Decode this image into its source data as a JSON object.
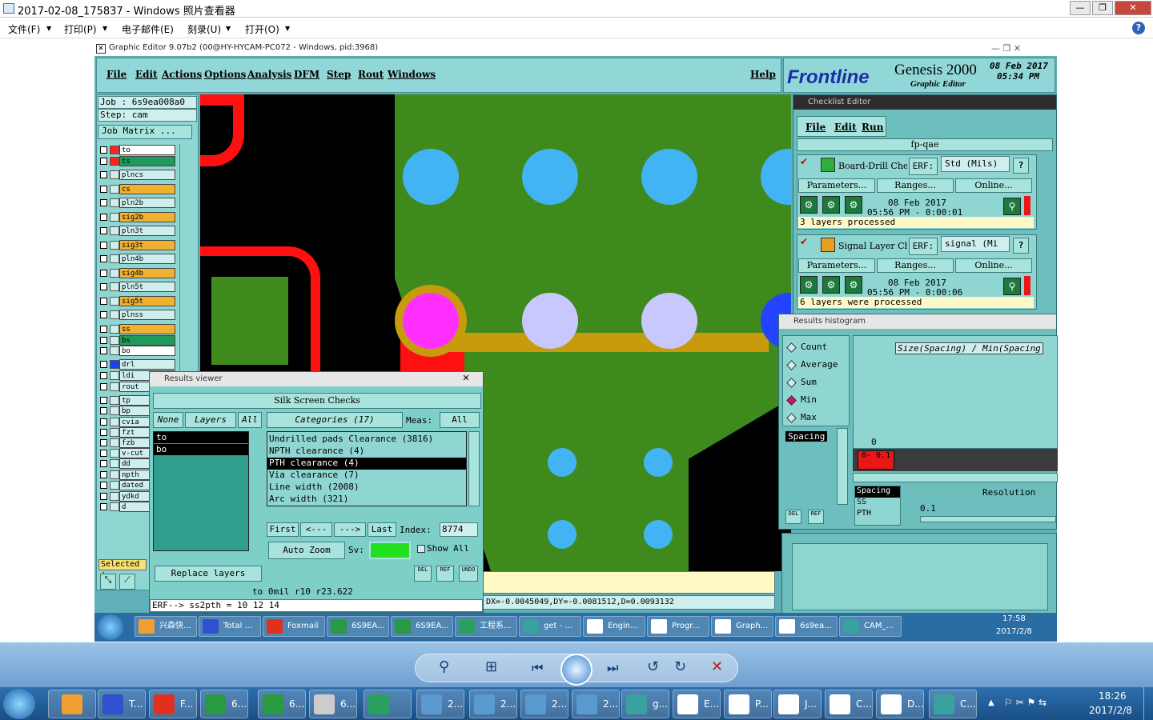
{
  "photo_viewer": {
    "title": "2017-02-08_175837 - Windows 照片查看器",
    "menu": [
      "文件(F)",
      "打印(P)",
      "电子邮件(E)",
      "刻录(U)",
      "打开(O)"
    ]
  },
  "graphic_editor": {
    "title": "Graphic Editor 9.07b2 (00@HY-HYCAM-PC072 - Windows, pid:3968)",
    "menu": [
      "File",
      "Edit",
      "Actions",
      "Options",
      "Analysis",
      "DFM",
      "Step",
      "Rout",
      "Windows"
    ],
    "help": "Help",
    "brand": "Frontline",
    "product": "Genesis 2000",
    "subtitle": "Graphic Editor",
    "date": "08 Feb 2017",
    "time": "05:34 PM",
    "job_label": "Job : 6s9ea008a0",
    "step_label": "Step: cam",
    "job_matrix": "Job Matrix ...",
    "layers": [
      {
        "name": "to",
        "color": "#ffffff"
      },
      {
        "name": "ts",
        "color": "#1f9a5a"
      },
      {
        "name": "plncs",
        "color": "#cfeeee"
      },
      {
        "name": "cs",
        "color": "#f0b030"
      },
      {
        "name": "pln2b",
        "color": "#cfeeee"
      },
      {
        "name": "sig2b",
        "color": "#f0b030"
      },
      {
        "name": "pln3t",
        "color": "#cfeeee"
      },
      {
        "name": "sig3t",
        "color": "#f0b030"
      },
      {
        "name": "pln4b",
        "color": "#cfeeee"
      },
      {
        "name": "sig4b",
        "color": "#f0b030"
      },
      {
        "name": "pln5t",
        "color": "#cfeeee"
      },
      {
        "name": "sig5t",
        "color": "#f0b030"
      },
      {
        "name": "plnss",
        "color": "#cfeeee"
      },
      {
        "name": "ss",
        "color": "#f0b030"
      },
      {
        "name": "bs",
        "color": "#1f9a5a"
      },
      {
        "name": "bo",
        "color": "#ffffff"
      },
      {
        "name": "drl",
        "color": "#cfeeee"
      },
      {
        "name": "ldi",
        "color": "#cfeeee"
      },
      {
        "name": "rout",
        "color": "#cfeeee"
      },
      {
        "name": "tp",
        "color": "#cfeeee"
      },
      {
        "name": "bp",
        "color": "#cfeeee"
      },
      {
        "name": "cvia",
        "color": "#cfeeee"
      },
      {
        "name": "fzt",
        "color": "#cfeeee"
      },
      {
        "name": "fzb",
        "color": "#cfeeee"
      },
      {
        "name": "v-cut",
        "color": "#cfeeee"
      },
      {
        "name": "dd",
        "color": "#cfeeee"
      },
      {
        "name": "npth",
        "color": "#cfeeee"
      },
      {
        "name": "dated",
        "color": "#cfeeee"
      },
      {
        "name": "ydkd",
        "color": "#cfeeee"
      },
      {
        "name": "d",
        "color": "#cfeeee"
      }
    ],
    "selected_label": "Selected :",
    "status_line": "DX=-0.0045049,DY=-0.0081512,D=0.0093132"
  },
  "results_viewer": {
    "title": "Results viewer",
    "header": "Silk Screen Checks",
    "none_btn": "None",
    "layers_btn": "Layers",
    "all_btn": "All",
    "categories_btn": "Categories (17)",
    "meas_label": "Meas:",
    "meas_value": "All",
    "layer_list": [
      "to",
      "bo"
    ],
    "categories": [
      "Undrilled pads Clearance (3816)",
      "NPTH clearance (4)",
      "PTH clearance (4)",
      "Via clearance (7)",
      "Line width (2008)",
      "Arc width (321)"
    ],
    "selected_category_index": 2,
    "first_btn": "First",
    "prev_btn": "<---",
    "next_btn": "--->",
    "last_btn": "Last",
    "index_label": "Index:",
    "index_value": "8774",
    "auto_zoom": "Auto Zoom",
    "sv_label": "Sv:",
    "show_all": "Show All",
    "replace_layers": "Replace layers",
    "del": "DEL",
    "ref": "REF",
    "undo": "UNDO",
    "info_line": "to 0mil  r10  r23.622",
    "erf_line": "ERF--> ss2pth = 10 12 14"
  },
  "checklist_editor": {
    "title": "Checklist Editor",
    "menu": [
      "File",
      "Edit",
      "Run"
    ],
    "checklist_name": "fp-qae",
    "checks": [
      {
        "name": "Board-Drill Che",
        "erf_label": "ERF:",
        "erf_value": "Std (Mils)",
        "parameters": "Parameters...",
        "ranges": "Ranges...",
        "online": "Online...",
        "date": "08 Feb 2017",
        "time": "05:56 PM - 0:00:01",
        "status": "3 layers processed",
        "icon_color": "#2fae3a"
      },
      {
        "name": "Signal Layer Ch",
        "erf_label": "ERF:",
        "erf_value": "signal (Mi",
        "parameters": "Parameters...",
        "ranges": "Ranges...",
        "online": "Online...",
        "date": "08 Feb 2017",
        "time": "05:56 PM - 0:00:06",
        "status": "6 layers were processed",
        "icon_color": "#e8a020"
      }
    ]
  },
  "results_histogram": {
    "title": "Results histogram",
    "options": [
      "Count",
      "Average",
      "Sum",
      "Min",
      "Max"
    ],
    "selected_option": "Min",
    "measure": "Spacing",
    "chart_title": "Size(Spacing) / Min(Spacing",
    "zero": "0",
    "bar_label": "0- 0.1",
    "list_items": [
      "Spacing",
      "SS",
      "PTH"
    ],
    "resolution_label": "Resolution",
    "resolution_value": "0.1",
    "del": "DEL",
    "ref": "REF"
  },
  "inner_taskbar": {
    "items": [
      "兴森快...",
      "Total ...",
      "Foxmail",
      "6S9EA...",
      "6S9EA...",
      "工程系...",
      "get - ...",
      "Engin...",
      "Progr...",
      "Graph...",
      "6s9ea...",
      "CAM_..."
    ],
    "time": "17:58",
    "date": "2017/2/8"
  },
  "taskbar": {
    "items": [
      "T...",
      "F...",
      "6...",
      "6...",
      "6...",
      "",
      "2...",
      "2...",
      "2...",
      "2...",
      "g...",
      "E...",
      "P...",
      "J...",
      "C...",
      "D...",
      "C..."
    ],
    "time": "18:26",
    "date": "2017/2/8"
  }
}
